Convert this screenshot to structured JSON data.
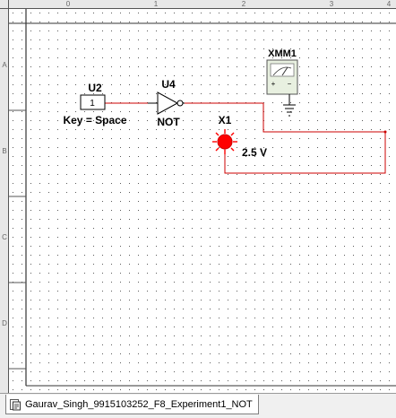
{
  "ruler": {
    "columns": [
      "0",
      "1",
      "2",
      "3",
      "4"
    ],
    "rows": [
      "A",
      "B",
      "C",
      "D"
    ]
  },
  "components": {
    "switch": {
      "ref": "U2",
      "value": "1",
      "key_label": "Key = Space"
    },
    "not_gate": {
      "ref": "U4",
      "type_label": "NOT"
    },
    "probe": {
      "ref": "X1",
      "voltage": "2.5 V"
    },
    "multimeter": {
      "ref": "XMM1",
      "plus": "+",
      "minus": "−"
    }
  },
  "tabs": [
    {
      "label": "Gaurav_Singh_9915103252_F8_Experiment1_NOT",
      "icon": "schematic-document-icon"
    }
  ],
  "colors": {
    "wire": "#cc0000",
    "probe": "#ff0000",
    "meter_face": "#e8f0e0",
    "grid_dot": "#5a5a5a"
  }
}
